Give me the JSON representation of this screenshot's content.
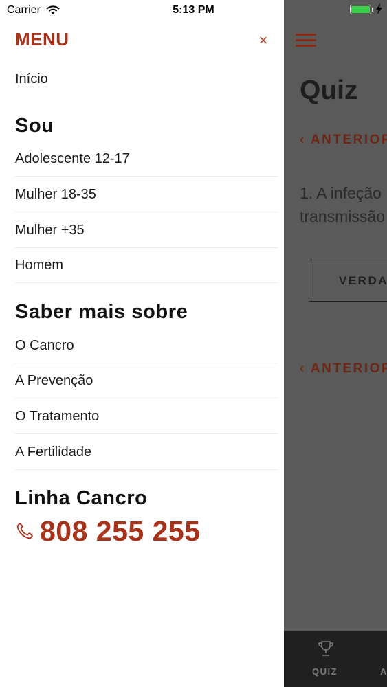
{
  "status_bar": {
    "carrier": "Carrier",
    "time": "5:13 PM"
  },
  "drawer": {
    "title": "MENU",
    "close_label": "×",
    "home": "Início",
    "section_sou": {
      "title": "Sou",
      "items": [
        "Adolescente 12-17",
        "Mulher 18-35",
        "Mulher +35",
        "Homem"
      ]
    },
    "section_saber": {
      "title": "Saber mais sobre",
      "items": [
        "O Cancro",
        "A Prevenção",
        "O Tratamento",
        "A Fertilidade"
      ]
    },
    "hotline": {
      "title": "Linha Cancro",
      "number": "808 255 255",
      "icon": "phone-icon"
    }
  },
  "background_app": {
    "title": "Quiz",
    "prev_label": "ANTERIOR",
    "question_line1": "1. A infeção",
    "question_line2": "transmissão",
    "answer_label": "VERDADEIRO",
    "tabs": [
      {
        "label": "QUIZ",
        "icon": "trophy-icon"
      },
      {
        "label": "A"
      }
    ]
  },
  "colors": {
    "accent": "#a8321a",
    "dim_overlay": "#5a5a5a"
  }
}
